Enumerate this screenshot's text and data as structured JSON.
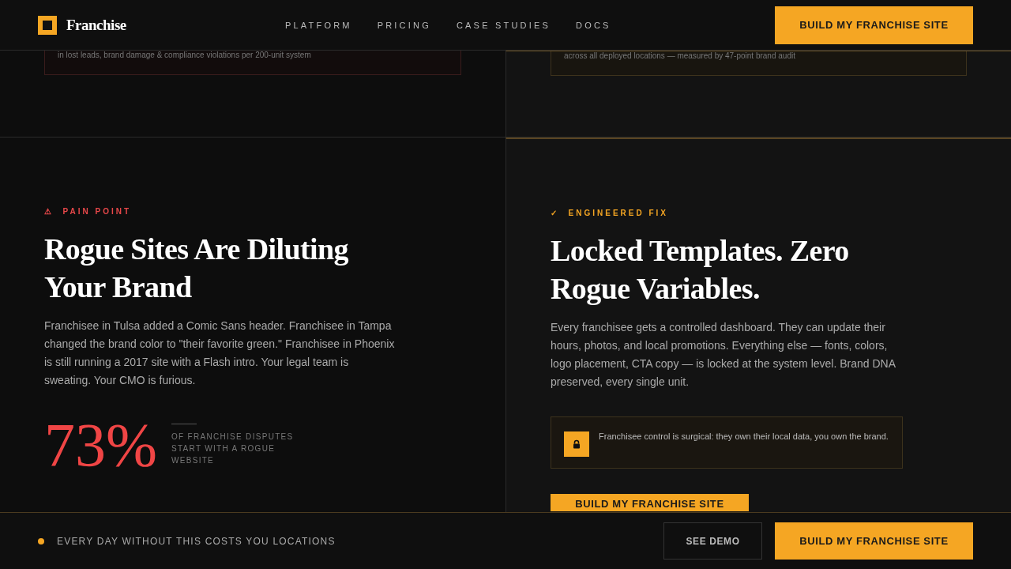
{
  "header": {
    "brand": "Franchise",
    "nav": [
      {
        "label": "PLATFORM"
      },
      {
        "label": "PRICING"
      },
      {
        "label": "CASE STUDIES"
      },
      {
        "label": "DOCS"
      }
    ],
    "cta": "BUILD MY FRANCHISE SITE"
  },
  "top_cards": [
    {
      "kind": "pain",
      "text": "in lost leads, brand damage & compliance violations per 200-unit system"
    },
    {
      "kind": "fix",
      "text": "across all deployed locations — measured by 47-point brand audit"
    }
  ],
  "pain": {
    "icon": "⚠",
    "label": "PAIN POINT",
    "title": "Rogue Sites Are Diluting Your Brand",
    "body": "Franchisee in Tulsa added a Comic Sans header. Franchisee in Tampa changed the brand color to \"their favorite green.\" Franchisee in Phoenix is still running a 2017 site with a Flash intro. Your legal team is sweating. Your CMO is furious.",
    "stat": "73%",
    "stat_caption": "OF FRANCHISE DISPUTES START WITH A ROGUE WEBSITE"
  },
  "fix": {
    "icon": "✓",
    "label": "ENGINEERED FIX",
    "title": "Locked Templates. Zero Rogue Variables.",
    "body": "Every franchisee gets a controlled dashboard. They can update their hours, photos, and local promotions. Everything else — fonts, colors, logo placement, CTA copy — is locked at the system level. Brand DNA preserved, every single unit.",
    "note": "Franchisee control is surgical: they own their local data, you own the brand.",
    "cta": "BUILD MY FRANCHISE SITE"
  },
  "bottom_bar": {
    "message": "EVERY DAY WITHOUT THIS COSTS YOU LOCATIONS",
    "demo": "SEE DEMO",
    "cta": "BUILD MY FRANCHISE SITE"
  }
}
